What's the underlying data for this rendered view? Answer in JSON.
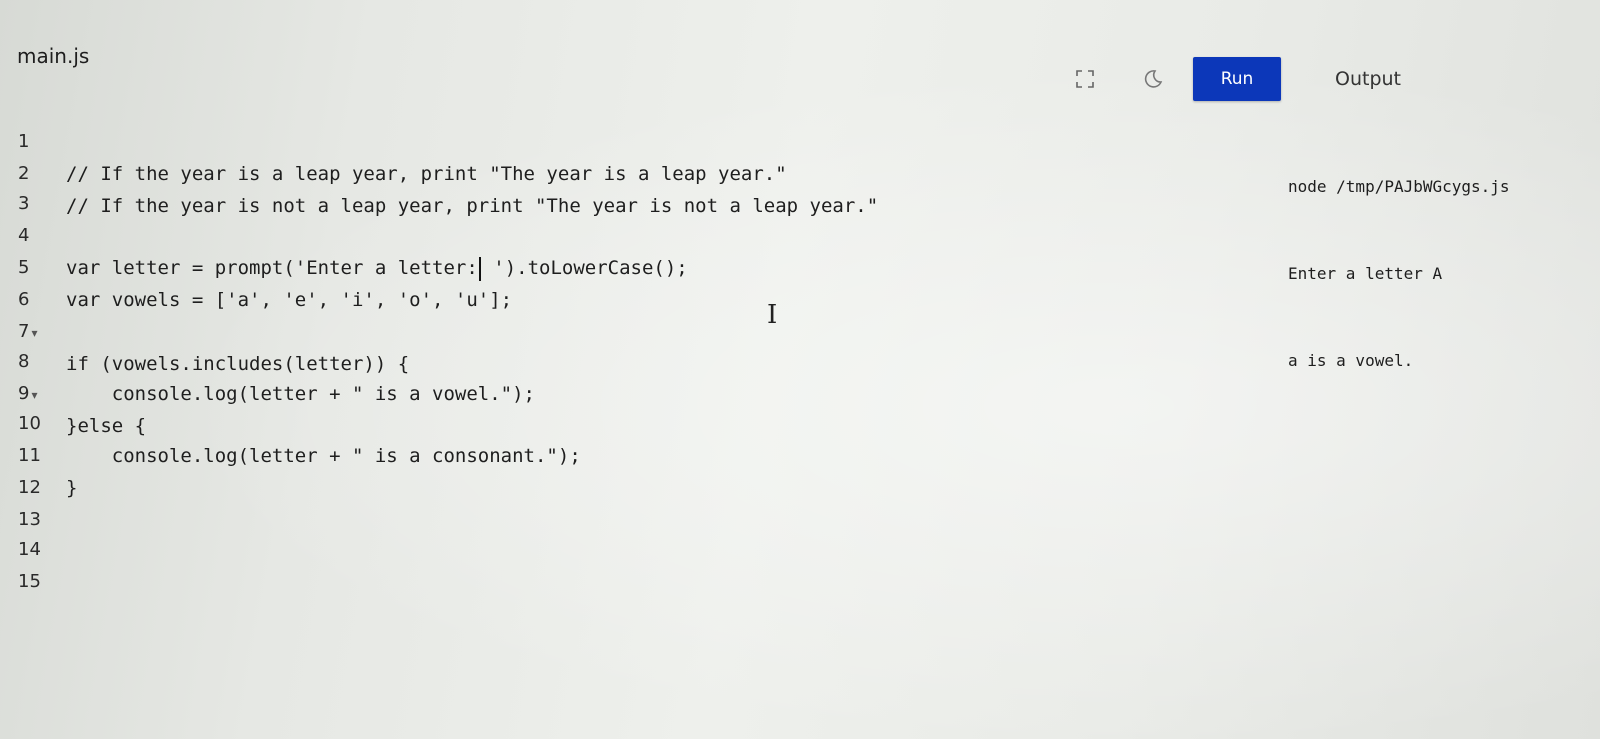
{
  "file_tab": {
    "label": "main.js"
  },
  "toolbar": {
    "expand_icon": "expand-icon",
    "theme_icon": "theme-toggle-icon",
    "run_label": "Run",
    "output_label": "Output",
    "run_color": "#0c37b9"
  },
  "editor": {
    "lines": [
      {
        "num": "1",
        "fold": "",
        "text": "// If the year is a leap year, print \"The year is a leap year.\""
      },
      {
        "num": "2",
        "fold": "",
        "text": "// If the year is not a leap year, print \"The year is not a leap year.\""
      },
      {
        "num": "3",
        "fold": "",
        "text": ""
      },
      {
        "num": "4",
        "fold": "",
        "text_before_caret": "var letter = prompt('Enter a letter:",
        "text_after_caret": " ').toLowerCase();"
      },
      {
        "num": "5",
        "fold": "",
        "text": "var vowels = ['a', 'e', 'i', 'o', 'u'];"
      },
      {
        "num": "6",
        "fold": "",
        "text": ""
      },
      {
        "num": "7",
        "fold": "▾",
        "text": "if (vowels.includes(letter)) {"
      },
      {
        "num": "8",
        "fold": "",
        "text": "    console.log(letter + \" is a vowel.\");"
      },
      {
        "num": "9",
        "fold": "▾",
        "text": "}else {"
      },
      {
        "num": "10",
        "fold": "",
        "text": "    console.log(letter + \" is a consonant.\");"
      },
      {
        "num": "11",
        "fold": "",
        "text": "}"
      },
      {
        "num": "12",
        "fold": "",
        "text": ""
      },
      {
        "num": "13",
        "fold": "",
        "text": ""
      },
      {
        "num": "14",
        "fold": "",
        "text": ""
      },
      {
        "num": "15",
        "fold": "",
        "text": ""
      }
    ]
  },
  "output": {
    "lines": [
      "node /tmp/PAJbWGcygs.js",
      "Enter a letter A",
      "a is a vowel."
    ]
  }
}
